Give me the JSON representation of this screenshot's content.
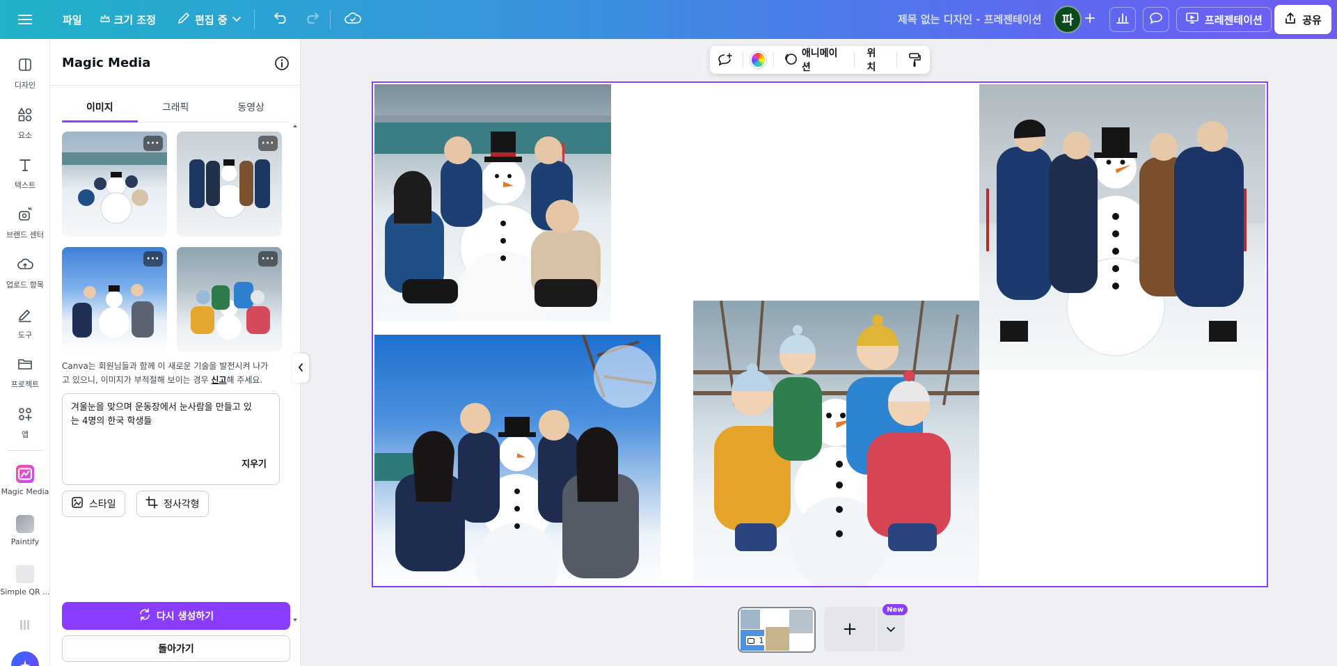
{
  "topbar": {
    "file_label": "파일",
    "resize_label": "크기 조정",
    "editing_label": "편집 중",
    "doc_title": "제목 없는 디자인 - 프레젠테이션",
    "avatar_initial": "파",
    "present_label": "프레젠테이션",
    "share_label": "공유"
  },
  "rail": {
    "items": [
      {
        "label": "디자인"
      },
      {
        "label": "요소"
      },
      {
        "label": "텍스트"
      },
      {
        "label": "브랜드 센터"
      },
      {
        "label": "업로드 항목"
      },
      {
        "label": "도구"
      },
      {
        "label": "프로젝트"
      },
      {
        "label": "앱"
      },
      {
        "label": "Magic Media"
      },
      {
        "label": "Paintify"
      },
      {
        "label": "Simple QR ..."
      }
    ]
  },
  "panel": {
    "title": "Magic Media",
    "tabs": [
      {
        "label": "이미지",
        "active": true
      },
      {
        "label": "그래픽",
        "active": false
      },
      {
        "label": "동영상",
        "active": false
      }
    ],
    "more_label": "···",
    "disclaimer_1": "Canva는 회원님들과 함께 이 새로운 기술을 발전시켜 나가고 있으니, 이미지가 부적절해 보이는 경우 ",
    "disclaimer_link": "신고",
    "disclaimer_2": "해 주세요.",
    "prompt_text": "겨울눈을 맞으며 운동장에서 눈사람을 만들고 있는 4명의 한국 학생들",
    "clear_label": "지우기",
    "style_label": "스타일",
    "aspect_label": "정사각형",
    "regenerate_label": "다시 생성하기",
    "back_label": "돌아가기"
  },
  "context_toolbar": {
    "animate_label": "애니메이션",
    "position_label": "위치"
  },
  "pages": {
    "current_page": "1",
    "new_badge": "New",
    "add_label": "+"
  },
  "colors": {
    "accent": "#8b3dff",
    "avatar_bg": "#0c4a1e"
  }
}
